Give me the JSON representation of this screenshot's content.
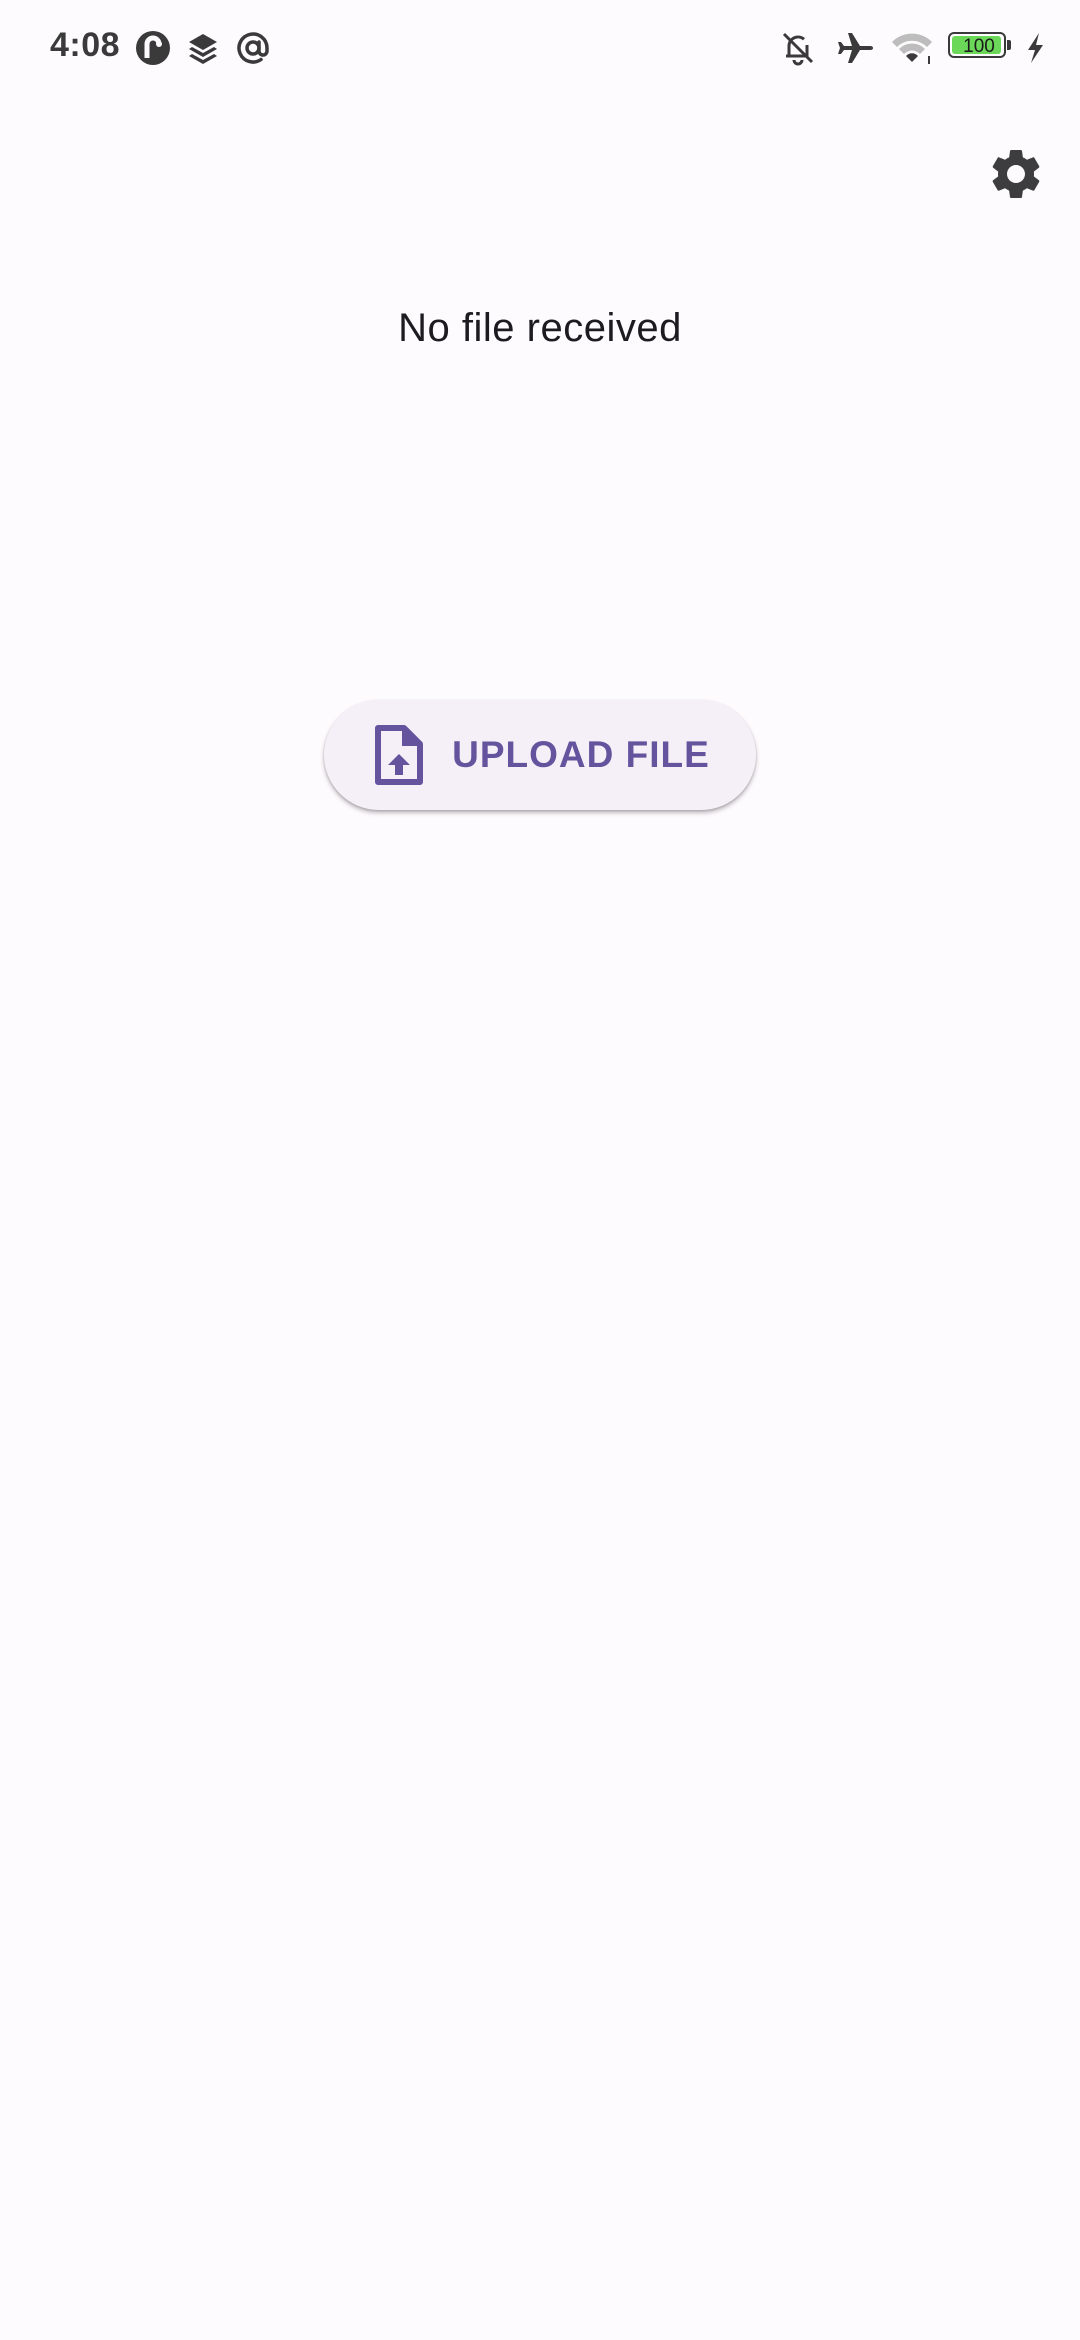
{
  "status_bar": {
    "time": "4:08",
    "icons": [
      "pocket-casts-icon",
      "layers-icon",
      "at-sign-icon",
      "bell-off-icon",
      "airplane-icon",
      "wifi-icon",
      "battery-icon",
      "charging-icon"
    ],
    "battery_level": "100",
    "battery_fraction": 1.0,
    "battery_color": "#6bd85a"
  },
  "toolbar": {
    "settings_icon": "gear-icon"
  },
  "main": {
    "message": "No file received",
    "upload_button_label": "UPLOAD FILE",
    "upload_icon": "file-upload-icon"
  },
  "colors": {
    "background": "#fefbfe",
    "accent": "#65539e",
    "button_background": "#f5f0f7",
    "icon_dark": "#3a3a3a"
  }
}
